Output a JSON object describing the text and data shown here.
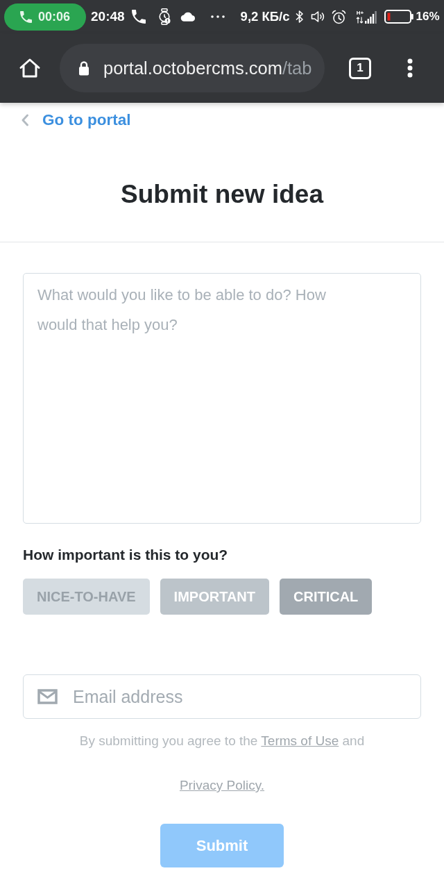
{
  "status_bar": {
    "call_timer": "00:06",
    "time": "20:48",
    "network_speed": "9,2 КБ/с",
    "network_type": "H+",
    "battery": "16%"
  },
  "browser": {
    "url_host": "portal.octobercms.com",
    "url_path": "/tab",
    "tab_count": "1"
  },
  "back_link": "Go to portal",
  "title": "Submit new idea",
  "idea_field": {
    "placeholder": "What would you like to be able to do? How would that help you?"
  },
  "importance": {
    "label": "How important is this to you?",
    "options": [
      {
        "label": "NICE-TO-HAVE",
        "color": "#d5dce1",
        "selected": false
      },
      {
        "label": "IMPORTANT",
        "color": "#bcc4ca",
        "selected": false
      },
      {
        "label": "CRITICAL",
        "color": "#a1a9b0",
        "selected": false
      }
    ]
  },
  "email_field": {
    "placeholder": "Email address"
  },
  "terms": [
    {
      "kind": "text",
      "text": "By submitting you agree to the"
    },
    {
      "kind": "link",
      "text": "Terms of Use"
    },
    {
      "kind": "text",
      "text": "and"
    },
    {
      "kind": "link",
      "text": "Privacy Policy."
    }
  ],
  "submit_button": {
    "label": "Submit",
    "disabled": true
  }
}
